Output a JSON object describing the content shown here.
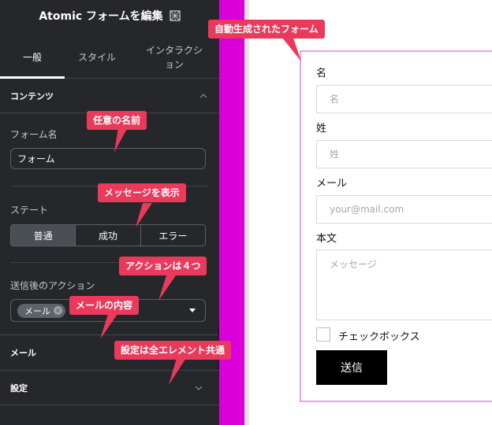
{
  "panel": {
    "title": "Atomic フォームを編集",
    "tabs": [
      {
        "label": "一般"
      },
      {
        "label": "スタイル"
      },
      {
        "label": "インタラクション"
      }
    ],
    "content_section": "コンテンツ",
    "form_name_label": "フォーム名",
    "form_name_value": "フォーム",
    "state_label": "ステート",
    "state_options": [
      "普通",
      "成功",
      "エラー"
    ],
    "action_label": "送信後のアクション",
    "action_chip": "メール",
    "mail_section": "メール",
    "settings_section": "設定"
  },
  "form": {
    "first_name_label": "名",
    "first_name_placeholder": "名",
    "last_name_label": "姓",
    "last_name_placeholder": "姓",
    "email_label": "メール",
    "email_placeholder": "your@mail.com",
    "body_label": "本文",
    "body_placeholder": "メッセージ",
    "checkbox_label": "チェックボックス",
    "submit_label": "送信"
  },
  "callouts": {
    "auto_form": "自動生成されたフォーム",
    "any_name": "任意の名前",
    "show_message": "メッセージを表示",
    "four_actions": "アクションは４つ",
    "mail_content": "メールの内容",
    "common_settings": "設定は全エレメント共通"
  },
  "colors": {
    "panel_bg": "#26272b",
    "accent_magenta": "#d900d9",
    "callout_red": "#ea3a5c",
    "frame_pink": "#e6a3ec"
  }
}
